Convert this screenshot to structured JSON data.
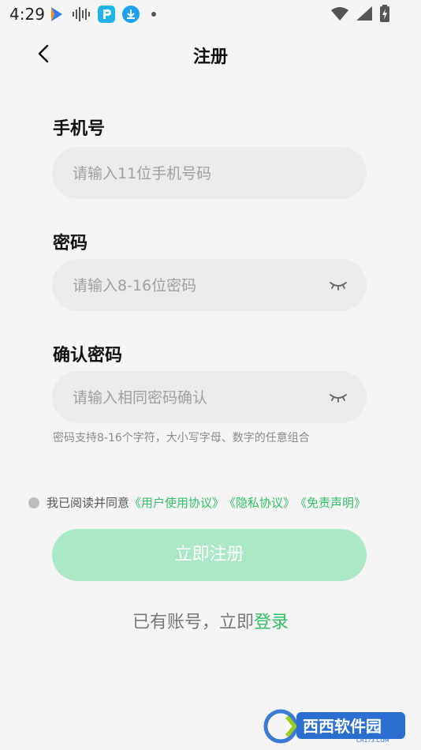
{
  "status_bar": {
    "time": "4:29",
    "icons": [
      "app-arrow-icon",
      "audio-wave-icon",
      "p-app-icon",
      "download-icon",
      "notification-dot-icon",
      "wifi-icon",
      "signal-icon",
      "battery-icon"
    ]
  },
  "nav": {
    "back_icon": "chevron-left-icon",
    "title": "注册"
  },
  "form": {
    "phone": {
      "label": "手机号",
      "placeholder": "请输入11位手机号码",
      "value": ""
    },
    "password": {
      "label": "密码",
      "placeholder": "请输入8-16位密码",
      "value": "",
      "toggle_icon": "eye-closed-icon"
    },
    "confirm": {
      "label": "确认密码",
      "placeholder": "请输入相同密码确认",
      "value": "",
      "toggle_icon": "eye-closed-icon"
    },
    "hint": "密码支持8-16个字符，大小写字母、数字的任意组合"
  },
  "agreement": {
    "prefix": "我已阅读并同意",
    "user_agreement": "《用户使用协议》",
    "privacy": "《隐私协议》",
    "disclaimer": "《免责声明》"
  },
  "submit": {
    "label": "立即注册"
  },
  "login": {
    "prefix": "已有账号，立即",
    "link": "登录"
  },
  "watermark": {
    "text": "西西软件园",
    "sub": "CR173.COM"
  },
  "colors": {
    "accent": "#2fbf64",
    "button_disabled": "#abe8c5",
    "field_bg": "#ebebeb",
    "background": "#f5f5f5"
  }
}
